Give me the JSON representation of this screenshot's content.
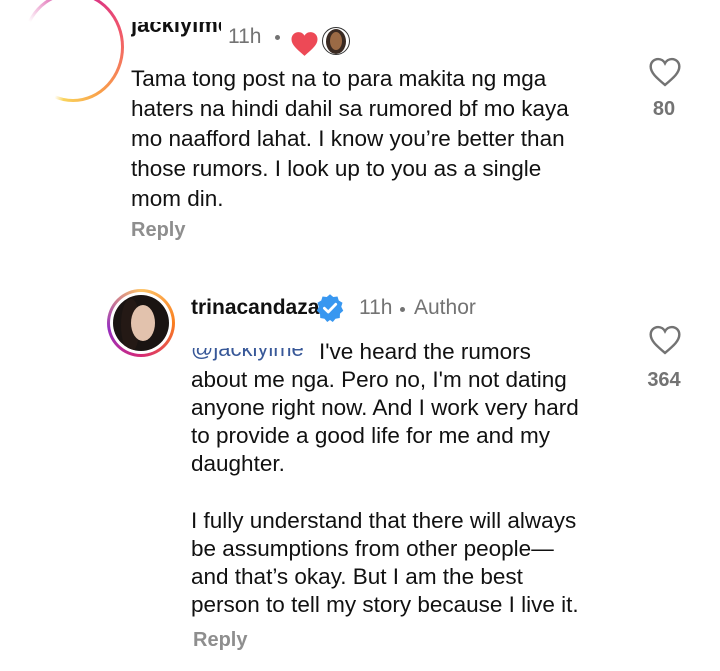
{
  "comments": [
    {
      "username": "jackiylme",
      "time": "11h",
      "text": "Tama tong post na to para makita ng mga\nhaters na hindi dahil sa rumored bf mo kaya\nmo naafford lahat. I know you’re better than\nthose rumors. I look up to you as a single\nmom din.",
      "reply_label": "Reply",
      "like_count": "80",
      "liked_by_author": true
    },
    {
      "username": "trinacandaza",
      "verified": true,
      "time": "11h",
      "author_label": "Author",
      "mention": "@jackiylme",
      "text_part1": "I've heard the rumors\nabout me nga. Pero no, I'm not dating\nanyone right now. And I work very hard\nto provide a good life for me and my\ndaughter.",
      "text_part2": "I fully understand that there will always\nbe assumptions from other people—\nand that’s okay. But I am the best\nperson to tell my story because I live it.",
      "reply_label": "Reply",
      "like_count": "364"
    }
  ],
  "colors": {
    "heart_red": "#ed4956",
    "verified_blue": "#3897f0",
    "secondary_text": "#737373",
    "reply_text": "#8e8e8e"
  },
  "icons": [
    "heart-outline-icon",
    "heart-filled-icon",
    "verified-badge-icon"
  ]
}
